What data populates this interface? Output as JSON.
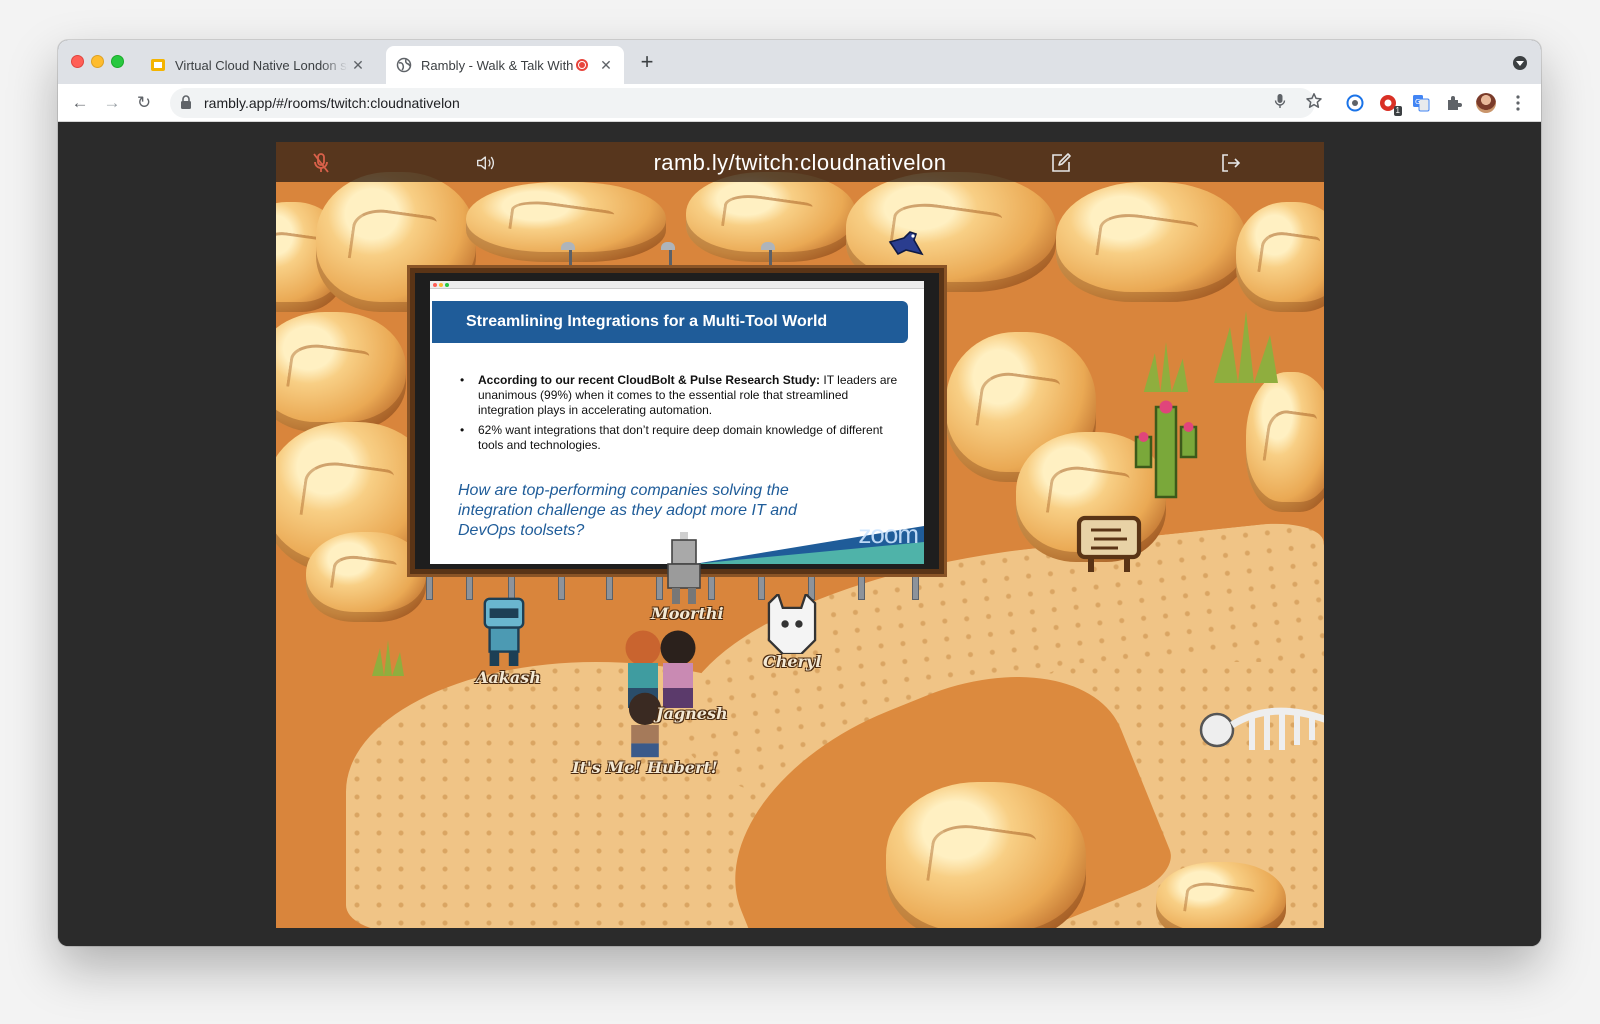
{
  "browser": {
    "tabs": [
      {
        "title": "Virtual Cloud Native London sli",
        "favicon": "slides-icon",
        "active": false
      },
      {
        "title": "Rambly - Walk & Talk With",
        "favicon": "globe-icon",
        "active": true,
        "recording": true
      }
    ],
    "close_glyph": "✕",
    "new_tab_glyph": "+",
    "url": "rambly.app/#/rooms/twitch:cloudnativelon",
    "nav": {
      "back": "←",
      "forward": "→",
      "reload": "↻"
    },
    "extension_badge": "1"
  },
  "game": {
    "room_title": "ramb.ly/twitch:cloudnativelon",
    "controls": [
      "mic-muted-icon",
      "speaker-icon",
      "edit-icon",
      "exit-icon"
    ],
    "slide": {
      "heading": "Streamlining Integrations for a Multi-Tool World",
      "bullet1_bold": "According to our recent CloudBolt & Pulse Research Study:",
      "bullet1_rest": "  IT leaders are unanimous (99%) when it comes to the essential role that streamlined integration plays in accelerating automation.",
      "bullet2": "62% want integrations that don’t require deep domain knowledge of different tools and technologies.",
      "question": "How are top-performing companies solving the integration challenge as they adopt more IT and DevOps toolsets?",
      "watermark": "zoom"
    },
    "players": [
      {
        "name": "Moorthi"
      },
      {
        "name": "Aakash"
      },
      {
        "name": "Cheryl"
      },
      {
        "name": "Jagnesh"
      },
      {
        "name": "It's Me! Hubert!"
      }
    ]
  },
  "colors": {
    "slide_banner": "#1f5c99",
    "sand": "#d9853c",
    "record": "#e8453c"
  }
}
